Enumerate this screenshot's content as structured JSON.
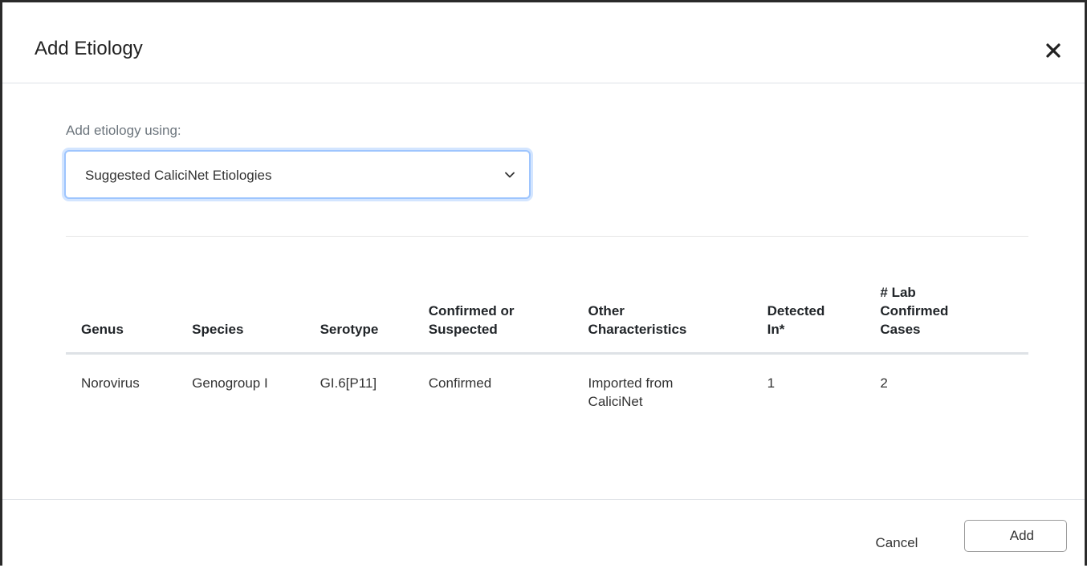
{
  "modal": {
    "title": "Add Etiology"
  },
  "form": {
    "label": "Add etiology using:",
    "select_value": "Suggested CaliciNet Etiologies"
  },
  "table": {
    "headers": {
      "genus": "Genus",
      "species": "Species",
      "serotype": "Serotype",
      "confirmed": "Confirmed or Suspected",
      "other": "Other Characteristics",
      "detected": "Detected In*",
      "lab_cases": "# Lab Confirmed Cases"
    },
    "rows": [
      {
        "genus": "Norovirus",
        "species": "Genogroup I",
        "serotype": "GI.6[P11]",
        "confirmed": "Confirmed",
        "other": "Imported from CaliciNet",
        "detected": "1",
        "lab_cases": "2"
      }
    ]
  },
  "footer": {
    "cancel_label": "Cancel",
    "add_label": "Add"
  },
  "icons": {
    "close": "close-icon",
    "chevron": "chevron-down-icon"
  }
}
